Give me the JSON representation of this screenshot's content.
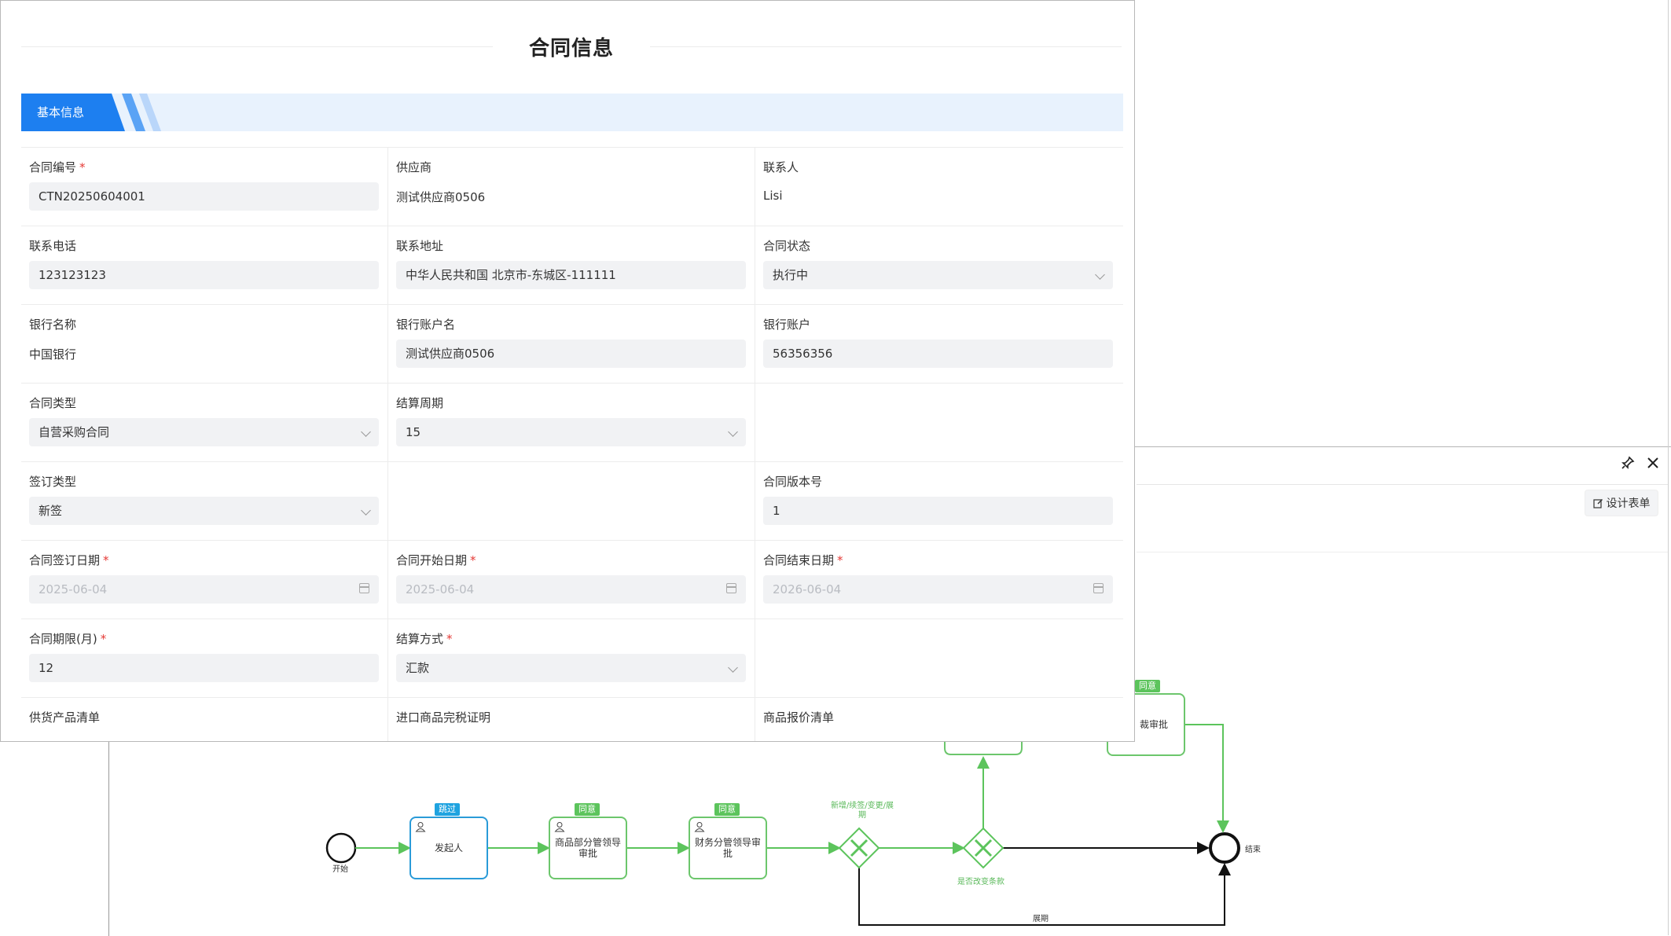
{
  "form": {
    "title": "合同信息",
    "section_tab": "基本信息",
    "rows": [
      [
        {
          "label": "合同编号",
          "required": true,
          "value": "CTN20250604001",
          "kind": "input"
        },
        {
          "label": "供应商",
          "required": false,
          "value": "测试供应商0506",
          "kind": "text"
        },
        {
          "label": "联系人",
          "required": false,
          "value": "Lisi",
          "kind": "text"
        }
      ],
      [
        {
          "label": "联系电话",
          "required": false,
          "value": "123123123",
          "kind": "input"
        },
        {
          "label": "联系地址",
          "required": false,
          "value": "中华人民共和国 北京市-东城区-111111",
          "kind": "input"
        },
        {
          "label": "合同状态",
          "required": false,
          "value": "执行中",
          "kind": "select"
        }
      ],
      [
        {
          "label": "银行名称",
          "required": false,
          "value": "中国银行",
          "kind": "text"
        },
        {
          "label": "银行账户名",
          "required": false,
          "value": "测试供应商0506",
          "kind": "input"
        },
        {
          "label": "银行账户",
          "required": false,
          "value": "56356356",
          "kind": "input"
        }
      ],
      [
        {
          "label": "合同类型",
          "required": false,
          "value": "自营采购合同",
          "kind": "select"
        },
        {
          "label": "结算周期",
          "required": false,
          "value": "15",
          "kind": "select"
        },
        {
          "label": "",
          "required": false,
          "value": "",
          "kind": "empty"
        }
      ],
      [
        {
          "label": "签订类型",
          "required": false,
          "value": "新签",
          "kind": "select"
        },
        {
          "label": "",
          "required": false,
          "value": "",
          "kind": "empty"
        },
        {
          "label": "合同版本号",
          "required": false,
          "value": "1",
          "kind": "input"
        }
      ],
      [
        {
          "label": "合同签订日期",
          "required": true,
          "value": "2025-06-04",
          "kind": "date"
        },
        {
          "label": "合同开始日期",
          "required": true,
          "value": "2025-06-04",
          "kind": "date"
        },
        {
          "label": "合同结束日期",
          "required": true,
          "value": "2026-06-04",
          "kind": "date"
        }
      ],
      [
        {
          "label": "合同期限(月)",
          "required": true,
          "value": "12",
          "kind": "input"
        },
        {
          "label": "结算方式",
          "required": true,
          "value": "汇款",
          "kind": "select"
        },
        {
          "label": "",
          "required": false,
          "value": "",
          "kind": "empty"
        }
      ],
      [
        {
          "label": "供货产品清单",
          "required": false,
          "value": "",
          "kind": "label-only"
        },
        {
          "label": "进口商品完税证明",
          "required": false,
          "value": "",
          "kind": "label-only"
        },
        {
          "label": "商品报价清单",
          "required": false,
          "value": "",
          "kind": "label-only"
        }
      ]
    ]
  },
  "workflow_window": {
    "pin_icon": "pin-icon",
    "close_icon": "close-icon",
    "design_form_label": "设计表单",
    "start_label": "开始",
    "end_label": "结束",
    "nodes": {
      "initiator": {
        "label": "发起人",
        "tag": "跳过"
      },
      "goods_leader": {
        "label": "商品部分管领导审批",
        "tag": "同意"
      },
      "finance_leader": {
        "label": "财务分管领导审批",
        "tag": "同意"
      },
      "top_right": {
        "label": "裁审批",
        "tag": "同意"
      }
    },
    "gateway1_label": "新增/续签/变更/展期",
    "gateway2_label": "是否改变条款",
    "bottom_path_label": "展期"
  },
  "colors": {
    "accent": "#1d7ff0",
    "flow_green": "#5cc45c",
    "skip_blue": "#1fa3e0"
  }
}
